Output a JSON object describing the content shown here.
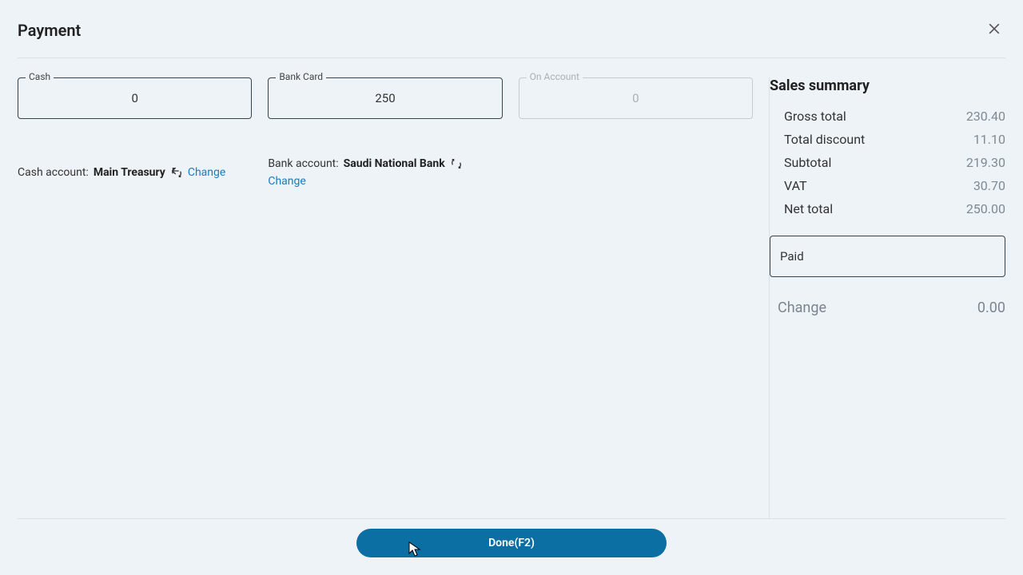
{
  "title": "Payment",
  "payment_methods": {
    "cash": {
      "label": "Cash",
      "value": "0"
    },
    "bank_card": {
      "label": "Bank Card",
      "value": "250"
    },
    "on_account": {
      "label": "On Account",
      "value": "0"
    }
  },
  "accounts": {
    "cash": {
      "label": "Cash account:",
      "name": "Main Treasury",
      "change": "Change"
    },
    "bank": {
      "label": "Bank account:",
      "name": "Saudi National Bank",
      "change": "Change"
    }
  },
  "summary": {
    "title": "Sales summary",
    "rows": {
      "gross_total": {
        "label": "Gross total",
        "value": "230.40"
      },
      "total_discount": {
        "label": "Total discount",
        "value": "11.10"
      },
      "subtotal": {
        "label": "Subtotal",
        "value": "219.30"
      },
      "vat": {
        "label": "VAT",
        "value": "30.70"
      },
      "net_total": {
        "label": "Net total",
        "value": "250.00"
      }
    },
    "paid": {
      "label": "Paid",
      "value": ""
    },
    "change": {
      "label": "Change",
      "value": "0.00"
    }
  },
  "footer": {
    "done": "Done(F2)"
  }
}
